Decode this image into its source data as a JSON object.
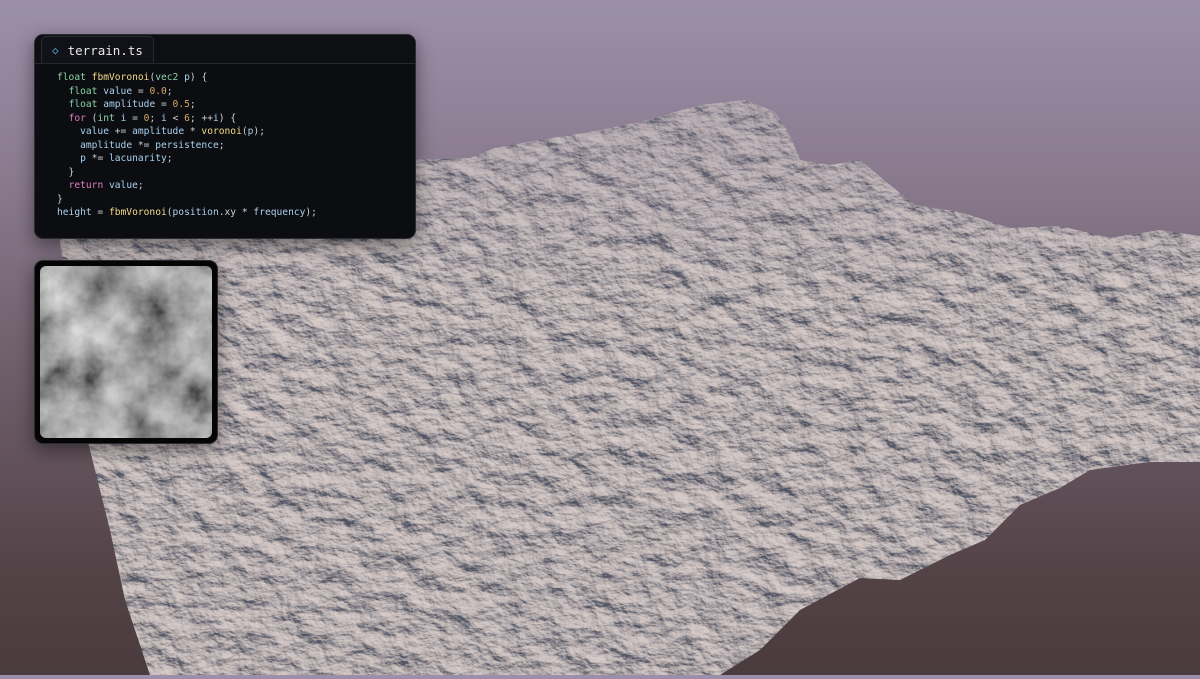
{
  "editor": {
    "tab_icon": "diamond-file-icon",
    "tab_label": "terrain.ts",
    "code_lines": [
      "float fbmVoronoi(vec2 p) {",
      "  float value = 0.0;",
      "  float amplitude = 0.5;",
      "  for (int i = 0; i < 6; ++i) {",
      "    value += amplitude * voronoi(p);",
      "    amplitude *= persistence;",
      "    p *= lacunarity;",
      "  }",
      "  return value;",
      "}",
      "height = fbmVoronoi(position.xy * frequency);"
    ]
  },
  "colors": {
    "sky_top": "#9c8fa9",
    "sky_bottom": "#4a3b3e",
    "terrain_light": "#b8aba6",
    "terrain_shadow": "#4e525f",
    "keyword": "#e07ec0",
    "type": "#8bd3a8",
    "function": "#f1dc8a",
    "number": "#d8a86b"
  }
}
